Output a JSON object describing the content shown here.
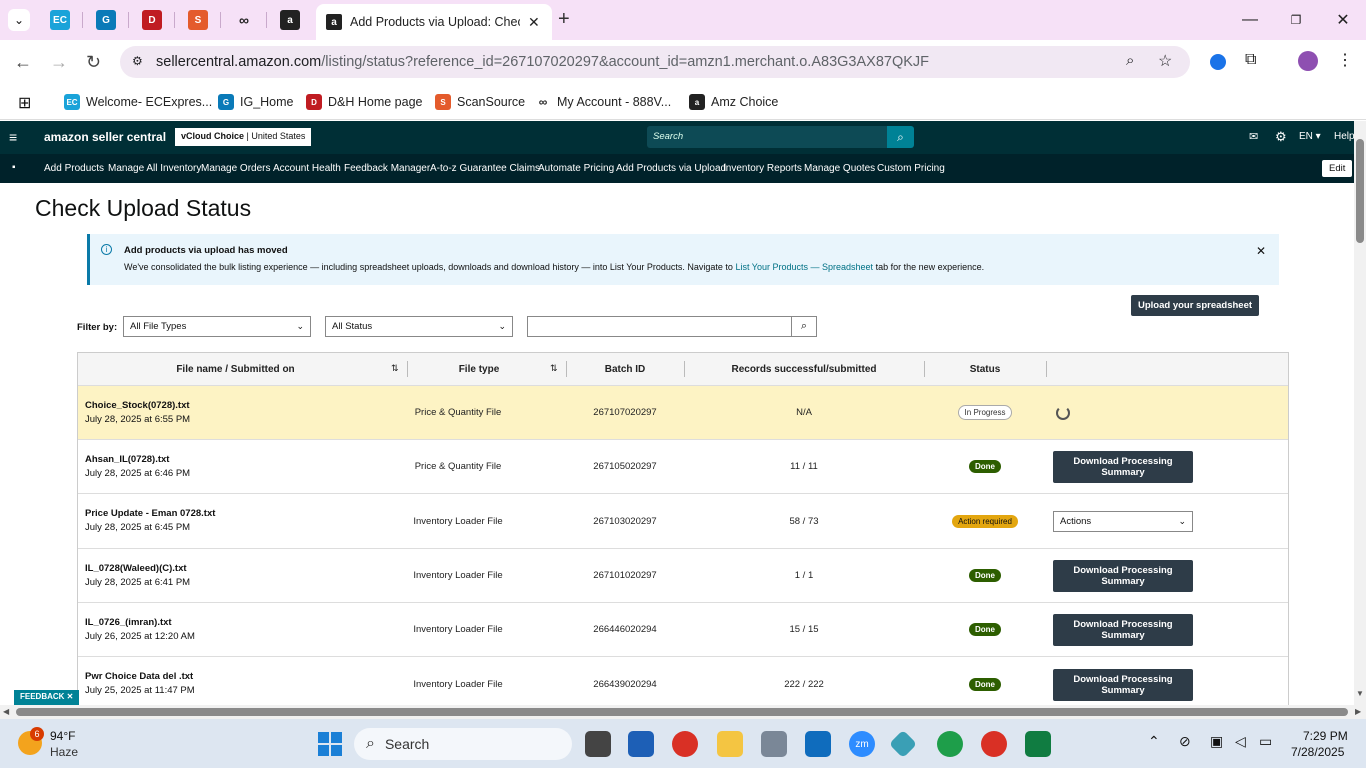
{
  "browser": {
    "active_tab_title": "Add Products via Upload: Check",
    "url_domain": "sellercentral.amazon.com",
    "url_path": "/listing/status?reference_id=267107020297&account_id=amzn1.merchant.o.A83G3AX87QKJF",
    "bookmarks": [
      {
        "label": "Welcome- ECExpres..."
      },
      {
        "label": "IG_Home"
      },
      {
        "label": "D&H Home page"
      },
      {
        "label": "ScanSource"
      },
      {
        "label": "My Account - 888V..."
      },
      {
        "label": "Amz Choice"
      }
    ]
  },
  "header": {
    "logo": "amazon seller central",
    "account": "vCloud Choice",
    "marketplace": "United States",
    "search_placeholder": "Search",
    "language": "EN",
    "help": "Help"
  },
  "nav": {
    "items": [
      "Add Products",
      "Manage All Inventory",
      "Manage Orders",
      "Account Health",
      "Feedback Manager",
      "A-to-z Guarantee Claims",
      "Automate Pricing",
      "Add Products via Upload",
      "Inventory Reports",
      "Manage Quotes",
      "Custom Pricing"
    ],
    "edit": "Edit"
  },
  "page": {
    "title": "Check Upload Status",
    "banner_title": "Add products via upload has moved",
    "banner_text": "We've consolidated the bulk listing experience — including spreadsheet uploads, downloads and download history — into List Your Products. Navigate to",
    "banner_link": "List Your Products — Spreadsheet",
    "banner_tail": "tab for the new experience.",
    "upload_button": "Upload your spreadsheet",
    "filter_label": "Filter by:",
    "file_type_filter": "All File Types",
    "status_filter": "All Status",
    "feedback": "FEEDBACK"
  },
  "table": {
    "headers": [
      "File name / Submitted on",
      "File type",
      "Batch ID",
      "Records successful/submitted",
      "Status"
    ],
    "rows": [
      {
        "name": "Choice_Stock(0728).txt",
        "date": "July 28, 2025 at 6:55 PM",
        "type": "Price & Quantity File",
        "batch": "267107020297",
        "records": "N/A",
        "status": "In Progress",
        "action": ""
      },
      {
        "name": "Ahsan_IL(0728).txt",
        "date": "July 28, 2025 at 6:46 PM",
        "type": "Price & Quantity File",
        "batch": "267105020297",
        "records": "11 / 11",
        "status": "Done",
        "action": "Download Processing Summary"
      },
      {
        "name": "Price Update - Eman 0728.txt",
        "date": "July 28, 2025 at 6:45 PM",
        "type": "Inventory Loader File",
        "batch": "267103020297",
        "records": "58 / 73",
        "status": "Action required",
        "action": "Actions"
      },
      {
        "name": "IL_0728(Waleed)(C).txt",
        "date": "July 28, 2025 at 6:41 PM",
        "type": "Inventory Loader File",
        "batch": "267101020297",
        "records": "1 / 1",
        "status": "Done",
        "action": "Download Processing Summary"
      },
      {
        "name": "IL_0726_(imran).txt",
        "date": "July 26, 2025 at 12:20 AM",
        "type": "Inventory Loader File",
        "batch": "266446020294",
        "records": "15 / 15",
        "status": "Done",
        "action": "Download Processing Summary"
      },
      {
        "name": "Pwr Choice Data del .txt",
        "date": "July 25, 2025 at 11:47 PM",
        "type": "Inventory Loader File",
        "batch": "266439020294",
        "records": "222 / 222",
        "status": "Done",
        "action": "Download Processing Summary"
      }
    ]
  },
  "taskbar": {
    "weather_temp": "94°F",
    "weather_desc": "Haze",
    "weather_badge": "6",
    "search": "Search",
    "time": "7:29 PM",
    "date": "7/28/2025"
  },
  "colors": {
    "header_bg": "#002f36",
    "nav_bg": "#00222a",
    "search_btn": "#008296",
    "done": "#2d5e00",
    "action_required": "#e3a60f"
  }
}
